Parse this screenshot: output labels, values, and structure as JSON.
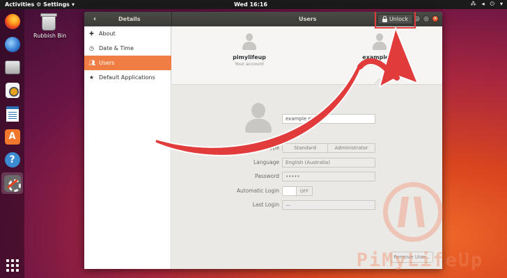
{
  "topbar": {
    "activities": "Activities",
    "app_name": "Settings",
    "clock": "Wed 16:16"
  },
  "desktop": {
    "trash_label": "Rubbish Bin"
  },
  "window": {
    "details_title": "Details",
    "users_title": "Users",
    "unlock_label": "Unlock",
    "annotation_color": "#e23b3b"
  },
  "sidebar": {
    "items": [
      {
        "icon": "plus-icon",
        "label": "About"
      },
      {
        "icon": "clock-icon",
        "label": "Date & Time"
      },
      {
        "icon": "users-icon",
        "label": "Users"
      },
      {
        "icon": "star-icon",
        "label": "Default Applications"
      }
    ],
    "selected_index": 2,
    "accent_color": "#f07e44"
  },
  "carousel": {
    "users": [
      {
        "name": "pimylifeup",
        "subtitle": "Your account"
      },
      {
        "name": "example pi",
        "subtitle": ""
      }
    ]
  },
  "account": {
    "full_name_value": "example pi user",
    "fields": {
      "account_type_label": "Account Type",
      "account_type_options": [
        "Standard",
        "Administrator"
      ],
      "language_label": "Language",
      "language_value": "English (Australia)",
      "password_label": "Password",
      "password_value": "•••••",
      "auto_login_label": "Automatic Login",
      "auto_login_state": "OFF",
      "last_login_label": "Last Login",
      "last_login_value": "—"
    },
    "remove_button": "Remove User..."
  },
  "watermark": {
    "text": "PiMyLifeUp"
  }
}
